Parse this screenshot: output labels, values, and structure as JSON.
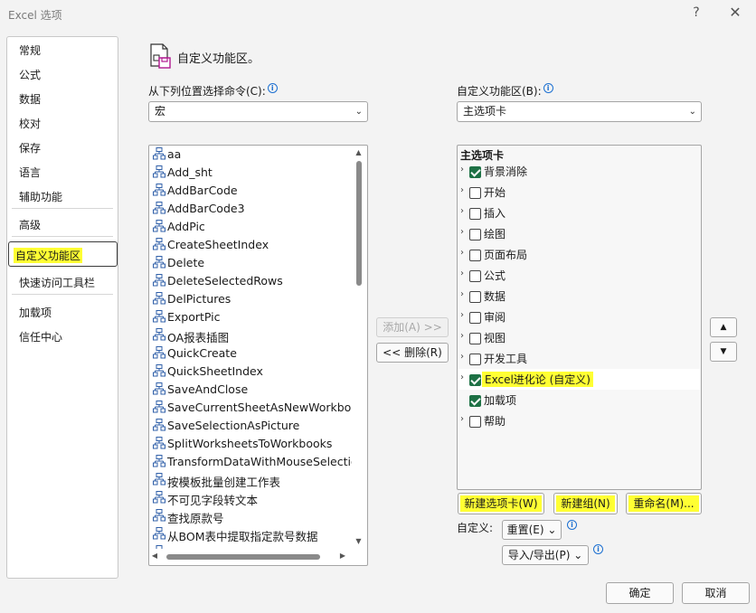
{
  "window": {
    "title": "Excel 选项",
    "help": "?",
    "close": "✕"
  },
  "nav": {
    "items": [
      {
        "label": "常规"
      },
      {
        "label": "公式"
      },
      {
        "label": "数据"
      },
      {
        "label": "校对"
      },
      {
        "label": "保存"
      },
      {
        "label": "语言"
      },
      {
        "label": "辅助功能"
      },
      {
        "label": "高级"
      },
      {
        "label": "自定义功能区",
        "selected": true
      },
      {
        "label": "快速访问工具栏"
      },
      {
        "label": "加载项"
      },
      {
        "label": "信任中心"
      }
    ]
  },
  "header": {
    "title": "自定义功能区。"
  },
  "left": {
    "choose_label": "从下列位置选择命令(C):",
    "choose_value": "宏",
    "commands": [
      "aa",
      "Add_sht",
      "AddBarCode",
      "AddBarCode3",
      "AddPic",
      "CreateSheetIndex",
      "Delete",
      "DeleteSelectedRows",
      "DelPictures",
      "ExportPic",
      "OA报表插图",
      "QuickCreate",
      "QuickSheetIndex",
      "SaveAndClose",
      "SaveCurrentSheetAsNewWorkbook",
      "SaveSelectionAsPicture",
      "SplitWorksheetsToWorkbooks",
      "TransformDataWithMouseSelection",
      "按模板批量创建工作表",
      "不可见字段转文本",
      "查找原款号",
      "从BOM表中提取指定款号数据",
      "单表拆分成多表"
    ]
  },
  "middle": {
    "add": "添加(A) >>",
    "remove": "<< 删除(R)"
  },
  "right": {
    "customize_label": "自定义功能区(B):",
    "customize_value": "主选项卡",
    "tree_header": "主选项卡",
    "tabs": [
      {
        "label": "背景消除",
        "checked": true,
        "expand": true
      },
      {
        "label": "开始",
        "checked": false,
        "expand": true
      },
      {
        "label": "插入",
        "checked": false,
        "expand": true
      },
      {
        "label": "绘图",
        "checked": false,
        "expand": true
      },
      {
        "label": "页面布局",
        "checked": false,
        "expand": true
      },
      {
        "label": "公式",
        "checked": false,
        "expand": true
      },
      {
        "label": "数据",
        "checked": false,
        "expand": true
      },
      {
        "label": "审阅",
        "checked": false,
        "expand": true
      },
      {
        "label": "视图",
        "checked": false,
        "expand": true
      },
      {
        "label": "开发工具",
        "checked": false,
        "expand": true
      },
      {
        "label": "Excel进化论 (自定义)",
        "checked": true,
        "expand": true,
        "selected": true
      },
      {
        "label": "加载项",
        "checked": true,
        "expand": false
      },
      {
        "label": "帮助",
        "checked": false,
        "expand": true
      }
    ],
    "new_tab": "新建选项卡(W)",
    "new_group": "新建组(N)",
    "rename": "重命名(M)...",
    "customize_text": "自定义:",
    "reset": "重置(E) ⌄",
    "import_export": "导入/导出(P) ⌄",
    "move_up": "▲",
    "move_down": "▼"
  },
  "footer": {
    "ok": "确定",
    "cancel": "取消"
  },
  "colors": {
    "highlight": "#ffff33",
    "checkbox": "#1e7145",
    "info": "#1b6fd1"
  }
}
